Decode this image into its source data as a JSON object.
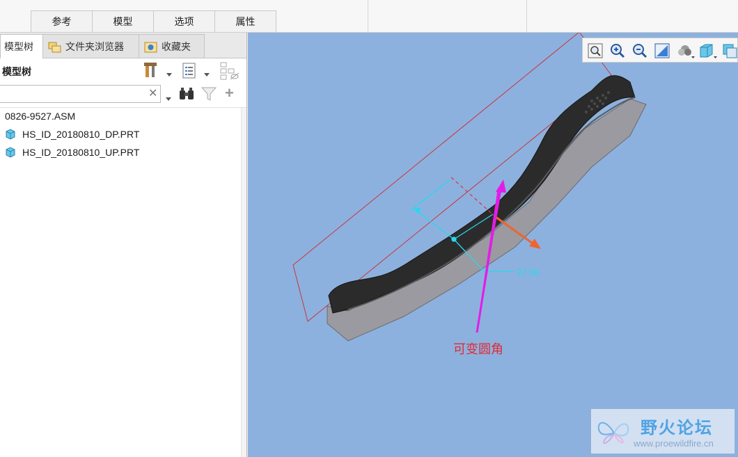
{
  "ribbon": {
    "tabs": [
      "参考",
      "模型",
      "选项",
      "属性"
    ]
  },
  "panel": {
    "tabs": [
      {
        "label": "模型树",
        "icon": "none"
      },
      {
        "label": "文件夹浏览器",
        "icon": "folder-browser-icon"
      },
      {
        "label": "收藏夹",
        "icon": "favorites-icon"
      }
    ],
    "active_tab": "模型树",
    "title": "模型树",
    "search": {
      "value": "",
      "placeholder": ""
    },
    "tree": {
      "root": "0826-9527.ASM",
      "items": [
        {
          "label": "HS_ID_20180810_DP.PRT",
          "icon": "part-icon"
        },
        {
          "label": "HS_ID_20180810_UP.PRT",
          "icon": "part-icon"
        }
      ]
    }
  },
  "viewport": {
    "dimension_value": "27.90",
    "annotation": "可变圆角",
    "toolbar_buttons": [
      "refit-icon",
      "zoom-in-icon",
      "zoom-out-icon",
      "repaint-icon",
      "appearance-icon",
      "display-style-icon",
      "saved-views-icon"
    ]
  },
  "watermark": {
    "title": "野火论坛",
    "url": "www.proewildfire.cn"
  },
  "colors": {
    "viewport_bg": "#8db1de",
    "part_body": "#2b2b2b",
    "part_side": "#9a9aa0",
    "plane_border": "#c8343d",
    "dimension": "#26d8ef",
    "arrow": "#e21ee6",
    "direction_arrow": "#f0642e",
    "annotation_text": "#e02a35"
  }
}
